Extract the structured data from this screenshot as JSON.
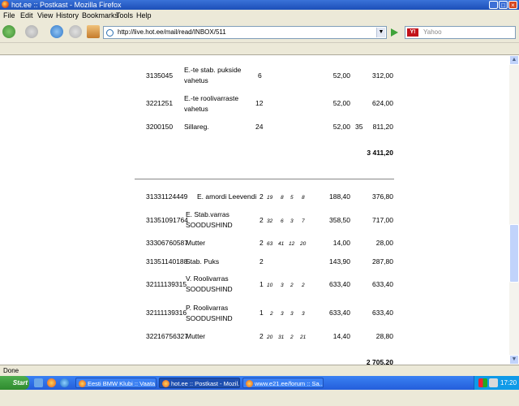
{
  "window": {
    "title": "hot.ee :: Postkast - Mozilla Firefox",
    "controls": [
      "_",
      "□",
      "×"
    ]
  },
  "menu": [
    "File",
    "Edit",
    "View",
    "History",
    "Bookmarks",
    "Tools",
    "Help"
  ],
  "nav": {
    "url": "http://live.hot.ee/mail/read/INBOX/511",
    "search_placeholder": "Yahoo",
    "search_logo": "Y!"
  },
  "content": {
    "rows_top": [
      {
        "code": "3135045",
        "desc": [
          "E.-te stab. pukside",
          "vahetus"
        ],
        "qty": "6",
        "extra": "",
        "price": "52,00",
        "total": "312,00"
      },
      {
        "code": "3221251",
        "desc": [
          "E.-te roolivarraste",
          "vahetus"
        ],
        "qty": "12",
        "extra": "",
        "price": "52,00",
        "total": "624,00"
      },
      {
        "code": "3200150",
        "desc": [
          "Sillareg."
        ],
        "qty": "24",
        "extra": "35",
        "price": "52,00",
        "total": "811,20"
      }
    ],
    "subtotal1": "3 411,20",
    "rows_bottom": [
      {
        "code": "31331124449",
        "desc": [
          "E. amordi Leevendi"
        ],
        "qty": "2",
        "n": [
          "19",
          "8",
          "5",
          "8"
        ],
        "price": "188,40",
        "total": "376,80"
      },
      {
        "code": "31351091764",
        "desc": [
          "E. Stab.varras",
          "SOODUSHIND"
        ],
        "qty": "2",
        "n": [
          "32",
          "6",
          "3",
          "7"
        ],
        "price": "358,50",
        "total": "717,00"
      },
      {
        "code": "33306760587",
        "desc": [
          "Mutter"
        ],
        "qty": "2",
        "n": [
          "63",
          "41",
          "12",
          "20"
        ],
        "price": "14,00",
        "total": "28,00"
      },
      {
        "code": "31351140188",
        "desc": [
          "Stab. Puks"
        ],
        "qty": "2",
        "n": [
          "",
          "",
          "",
          ""
        ],
        "price": "143,90",
        "total": "287,80"
      },
      {
        "code": "32111139315",
        "desc": [
          "V. Roolivarras",
          "SOODUSHIND"
        ],
        "qty": "1",
        "n": [
          "10",
          "3",
          "2",
          "2"
        ],
        "price": "633,40",
        "total": "633,40"
      },
      {
        "code": "32111139316",
        "desc": [
          "P. Roolivarras",
          "SOODUSHIND"
        ],
        "qty": "1",
        "n": [
          "2",
          "3",
          "3",
          "3"
        ],
        "price": "633,40",
        "total": "633,40"
      },
      {
        "code": "32216756327",
        "desc": [
          "Mutter"
        ],
        "qty": "2",
        "n": [
          "20",
          "31",
          "2",
          "21"
        ],
        "price": "14,40",
        "total": "28,80"
      }
    ],
    "subtotal2": "2 705,20"
  },
  "status": "Done",
  "taskbar": {
    "start_label": "Start",
    "tasks": [
      "Eesti BMW Klubi :: Vaata ...",
      "hot.ee :: Postkast - Mozil...",
      "www.e21.ee/forum :: Sa..."
    ],
    "clock": "17:20"
  },
  "colors": {
    "titlebar": "#245edb",
    "taskbar": "#245edb",
    "start": "#3c9c3c",
    "content_bg": "#ffffff"
  }
}
